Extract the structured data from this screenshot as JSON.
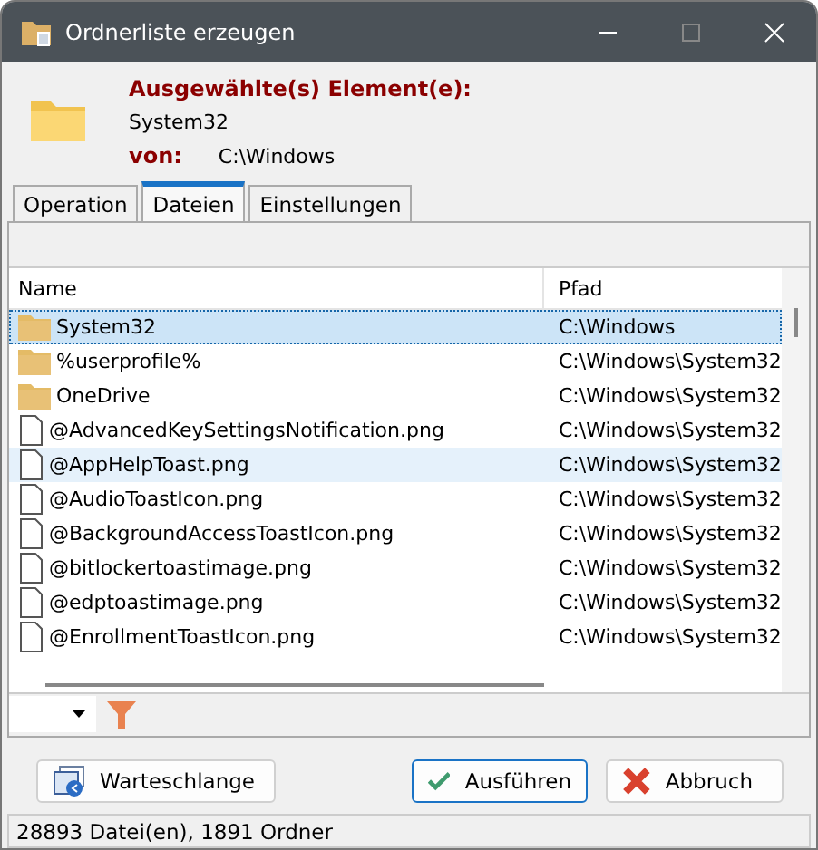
{
  "window": {
    "title": "Ordnerliste erzeugen"
  },
  "header": {
    "selected_label": "Ausgewählte(s) Element(e):",
    "selected_value": "System32",
    "from_label": "von:",
    "from_value": "C:\\Windows"
  },
  "tabs": [
    {
      "label": "Operation",
      "selected": false
    },
    {
      "label": "Dateien",
      "selected": true
    },
    {
      "label": "Einstellungen",
      "selected": false
    }
  ],
  "table": {
    "columns": [
      "Name",
      "Pfad"
    ],
    "rows": [
      {
        "kind": "folder",
        "name": "System32",
        "path": "C:\\Windows",
        "selected": true,
        "hovered": false
      },
      {
        "kind": "folder",
        "name": "%userprofile%",
        "path": "C:\\Windows\\System32",
        "selected": false,
        "hovered": false
      },
      {
        "kind": "folder",
        "name": "OneDrive",
        "path": "C:\\Windows\\System32",
        "selected": false,
        "hovered": false
      },
      {
        "kind": "file",
        "name": "@AdvancedKeySettingsNotification.png",
        "path": "C:\\Windows\\System32",
        "selected": false,
        "hovered": false
      },
      {
        "kind": "file",
        "name": "@AppHelpToast.png",
        "path": "C:\\Windows\\System32",
        "selected": false,
        "hovered": true
      },
      {
        "kind": "file",
        "name": "@AudioToastIcon.png",
        "path": "C:\\Windows\\System32",
        "selected": false,
        "hovered": false
      },
      {
        "kind": "file",
        "name": "@BackgroundAccessToastIcon.png",
        "path": "C:\\Windows\\System32",
        "selected": false,
        "hovered": false
      },
      {
        "kind": "file",
        "name": "@bitlockertoastimage.png",
        "path": "C:\\Windows\\System32",
        "selected": false,
        "hovered": false
      },
      {
        "kind": "file",
        "name": "@edptoastimage.png",
        "path": "C:\\Windows\\System32",
        "selected": false,
        "hovered": false
      },
      {
        "kind": "file",
        "name": "@EnrollmentToastIcon.png",
        "path": "C:\\Windows\\System32",
        "selected": false,
        "hovered": false
      }
    ]
  },
  "buttons": [
    {
      "kind": "queue",
      "label": "Warteschlange"
    },
    {
      "kind": "run",
      "label": "Ausführen"
    },
    {
      "kind": "cancel",
      "label": "Abbruch"
    }
  ],
  "status_bar": "28893 Datei(en), 1891 Ordner"
}
